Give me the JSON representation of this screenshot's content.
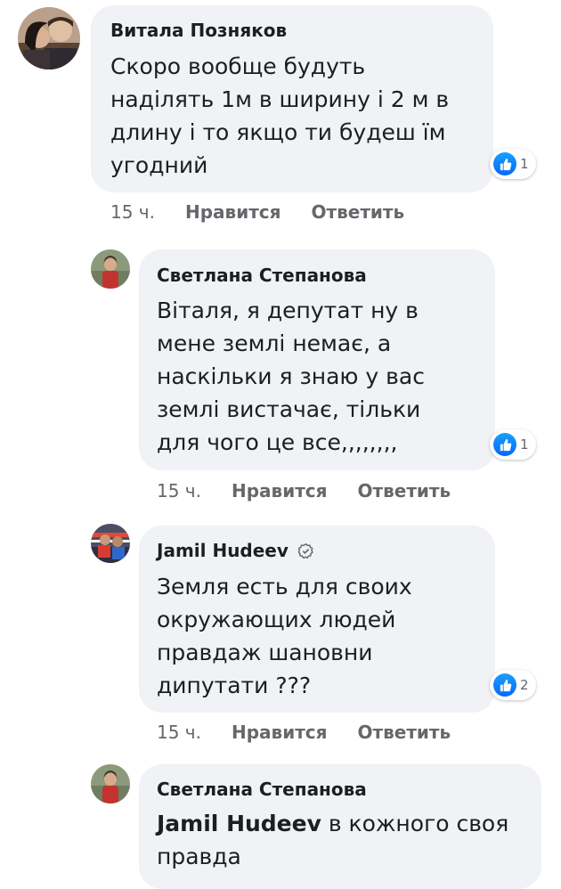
{
  "comments": [
    {
      "author": "Витала Позняков",
      "text": "Скоро вообще будуть\nнаділять  1м в ширину і 2 м в\nдлину   і то якщо ти будеш їм\nугодний",
      "reactions": "1",
      "time": "15 ч.",
      "like_label": "Нравится",
      "reply_label": "Ответить"
    },
    {
      "author": "Светлана Степанова",
      "text": "Віталя, я депутат  ну в\nмене землі немає, а\nнаскільки я знаю у вас\nземлі вистачає, тільки\nдля чого це  все,,,,,,,,",
      "reactions": "1",
      "time": "15 ч.",
      "like_label": "Нравится",
      "reply_label": "Ответить"
    },
    {
      "author": "Jamil Hudeev",
      "verified_icon": "verified-badge-icon",
      "text": "Земля есть для своих\nокружающих  людей\nправдаж шановни\nдипутати  ???",
      "reactions": "2",
      "time": "15 ч.",
      "like_label": "Нравится",
      "reply_label": "Ответить"
    },
    {
      "author": "Светлана Степанова",
      "mention": "Jamil Hudeev",
      "text": " в кожного своя\nправда"
    }
  ],
  "colors": {
    "bubble": "#f0f2f5",
    "meta": "#65676b",
    "like_blue": "#0866ff"
  },
  "icons": {
    "like": "thumbs-up-icon"
  }
}
